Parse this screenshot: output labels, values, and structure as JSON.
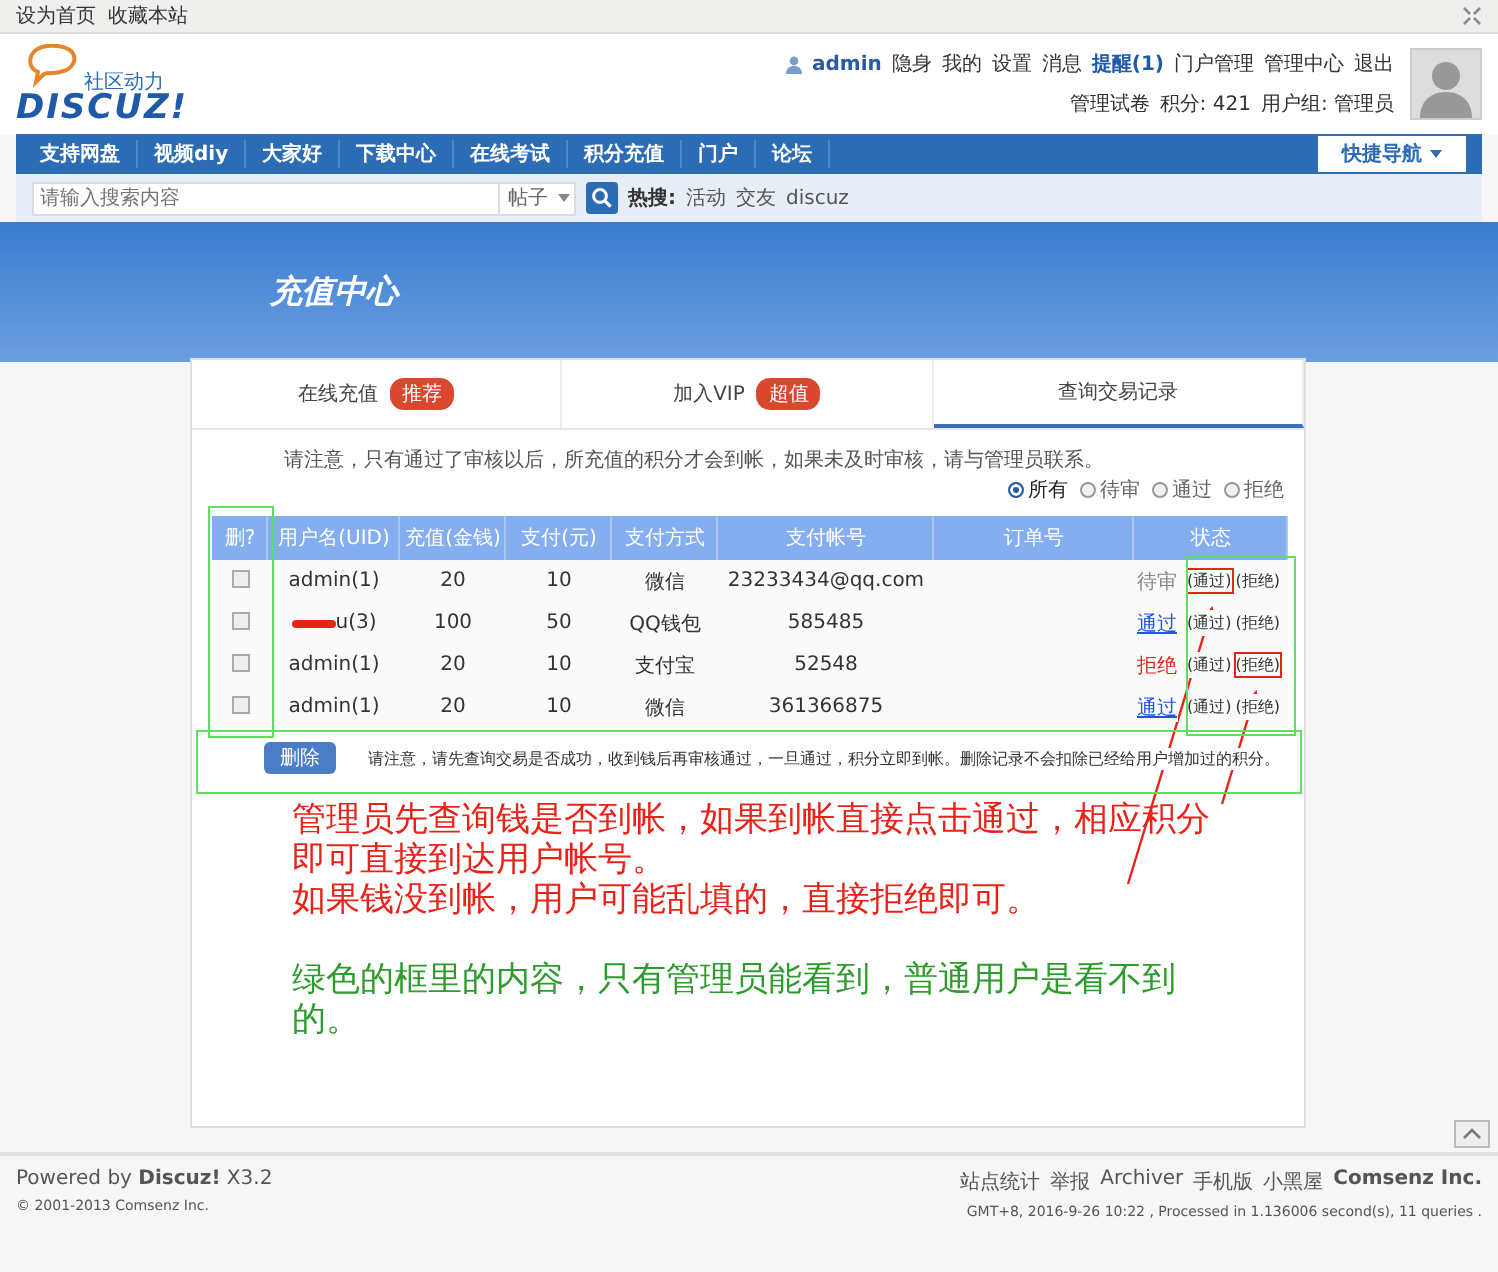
{
  "top_bar": {
    "links": [
      "设为首页",
      "收藏本站"
    ]
  },
  "header": {
    "logo": {
      "tagline": "社区动力",
      "wordmark": "DISCUZ!"
    },
    "user": "admin",
    "user_status": "隐身",
    "links": [
      "我的",
      "设置",
      "消息",
      "提醒(1)",
      "门户管理",
      "管理中心",
      "退出"
    ],
    "sub_links": [
      "管理试卷",
      "积分: 421",
      "用户组: 管理员"
    ]
  },
  "nav": {
    "items": [
      "支持网盘",
      "视频diy",
      "大家好",
      "下载中心",
      "在线考试",
      "积分充值",
      "门户",
      "论坛"
    ],
    "quick_nav": "快捷导航"
  },
  "search": {
    "placeholder": "请输入搜索内容",
    "type": "帖子",
    "hot_label": "热搜:",
    "hot": [
      "活动",
      "交友",
      "discuz"
    ]
  },
  "banner": {
    "title": "充值中心"
  },
  "tabs": [
    {
      "label": "在线充值",
      "badge": "推荐",
      "selected": false
    },
    {
      "label": "加入VIP",
      "badge": "超值",
      "selected": false
    },
    {
      "label": "查询交易记录",
      "selected": true
    }
  ],
  "notice": "请注意，只有通过了审核以后，所充值的积分才会到帐，如果未及时审核，请与管理员联系。",
  "filters": [
    {
      "label": "所有",
      "selected": true
    },
    {
      "label": "待审",
      "selected": false
    },
    {
      "label": "通过",
      "selected": false
    },
    {
      "label": "拒绝",
      "selected": false
    }
  ],
  "table": {
    "columns": [
      "删?",
      "用户名(UID)",
      "充值(金钱)",
      "支付(元)",
      "支付方式",
      "支付帐号",
      "订单号",
      "状态"
    ],
    "rows": [
      {
        "checked": false,
        "user": "admin(1)",
        "amount": "20",
        "paid": "10",
        "method": "微信",
        "account": "23233434@qq.com",
        "status": {
          "kind": "pending",
          "label": "待审"
        },
        "actions": [
          {
            "label": "(通过)",
            "highlighted": true
          },
          {
            "label": "(拒绝)",
            "highlighted": false
          }
        ]
      },
      {
        "checked": false,
        "user": "u(3)",
        "redacted": true,
        "amount": "100",
        "paid": "50",
        "method": "QQ钱包",
        "account": "585485",
        "status": {
          "kind": "approved",
          "label": "通过"
        },
        "actions": [
          {
            "label": "(通过)",
            "highlighted": false
          },
          {
            "label": "(拒绝)",
            "highlighted": false
          }
        ]
      },
      {
        "checked": false,
        "user": "admin(1)",
        "amount": "20",
        "paid": "10",
        "method": "支付宝",
        "account": "52548",
        "status": {
          "kind": "rejected",
          "label": "拒绝"
        },
        "actions": [
          {
            "label": "(通过)",
            "highlighted": false
          },
          {
            "label": "(拒绝)",
            "highlighted": true
          }
        ]
      },
      {
        "checked": false,
        "user": "admin(1)",
        "amount": "20",
        "paid": "10",
        "method": "微信",
        "account": "361366875",
        "status": {
          "kind": "approved",
          "label": "通过"
        },
        "actions": [
          {
            "label": "(通过)",
            "highlighted": false
          },
          {
            "label": "(拒绝)",
            "highlighted": false
          }
        ]
      }
    ]
  },
  "delete_button": "删除",
  "footer_note": "请注意，请先查询交易是否成功，收到钱后再审核通过，一旦通过，积分立即到帐。删除记录不会扣除已经给用户增加过的积分。",
  "annotations": [
    {
      "text": "管理员先查询钱是否到帐，如果到帐直接点击通过，相应积分即可直接到达用户帐号。",
      "color": "#e8231a"
    },
    {
      "text": "如果钱没到帐，用户可能乱填的，直接拒绝即可。",
      "color": "#e8231a"
    },
    {
      "text": "绿色的框里的内容，只有管理员能看到，普通用户是看不到的。",
      "color": "#2e9b2e"
    }
  ],
  "footer": {
    "powered": "Powered by **Discuz!** X3.2",
    "copyright": "© 2001-2013 Comsenz Inc.",
    "links": [
      "站点统计",
      "举报",
      "Archiver",
      "手机版",
      "小黑屋"
    ],
    "company": "Comsenz Inc.",
    "stats": "GMT+8, 2016-9-26 10:22 , Processed in 1.136006 second(s), 11 queries ."
  }
}
